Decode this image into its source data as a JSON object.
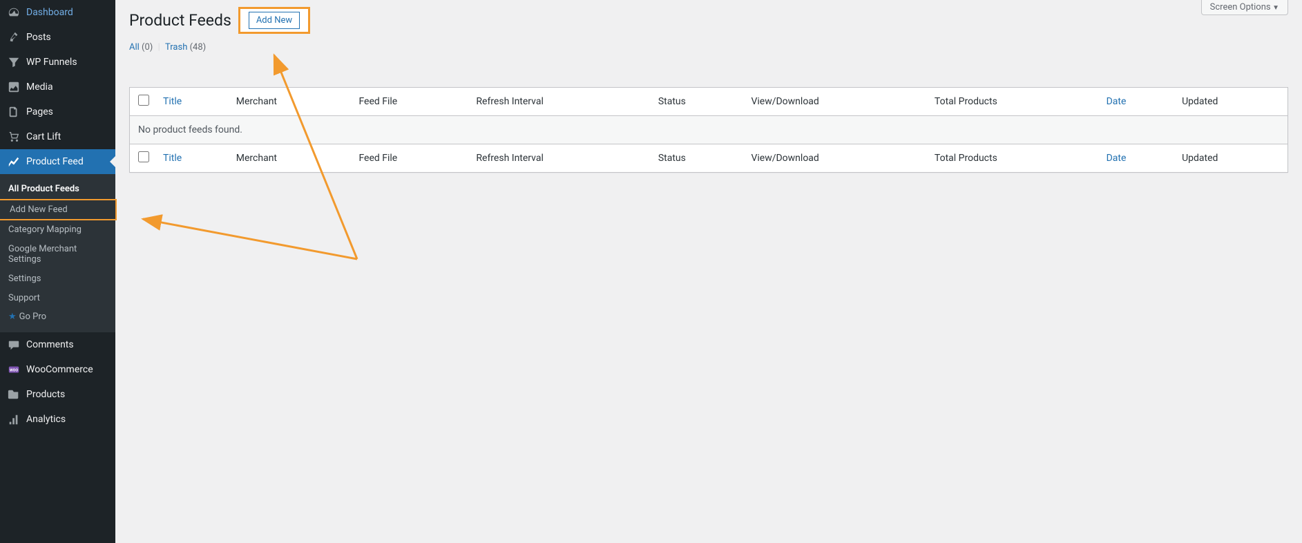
{
  "sidebar": {
    "items": [
      {
        "label": "Dashboard",
        "icon": "dashboard"
      },
      {
        "label": "Posts",
        "icon": "pin"
      },
      {
        "label": "WP Funnels",
        "icon": "funnel"
      },
      {
        "label": "Media",
        "icon": "media"
      },
      {
        "label": "Pages",
        "icon": "pages"
      },
      {
        "label": "Cart Lift",
        "icon": "cart"
      },
      {
        "label": "Product Feed",
        "icon": "chart"
      },
      {
        "label": "Comments",
        "icon": "comment"
      },
      {
        "label": "WooCommerce",
        "icon": "woo"
      },
      {
        "label": "Products",
        "icon": "products"
      },
      {
        "label": "Analytics",
        "icon": "analytics"
      }
    ],
    "submenu": {
      "items": [
        {
          "label": "All Product Feeds"
        },
        {
          "label": "Add New Feed"
        },
        {
          "label": "Category Mapping"
        },
        {
          "label": "Google Merchant Settings"
        },
        {
          "label": "Settings"
        },
        {
          "label": "Support"
        },
        {
          "label": "Go Pro"
        }
      ]
    }
  },
  "header": {
    "screen_options": "Screen Options",
    "page_title": "Product Feeds",
    "add_new": "Add New"
  },
  "filters": {
    "all_label": "All",
    "all_count": "(0)",
    "trash_label": "Trash",
    "trash_count": "(48)"
  },
  "table": {
    "columns": {
      "title": "Title",
      "merchant": "Merchant",
      "feed_file": "Feed File",
      "refresh_interval": "Refresh Interval",
      "status": "Status",
      "view_download": "View/Download",
      "total_products": "Total Products",
      "date": "Date",
      "updated": "Updated"
    },
    "empty_message": "No product feeds found."
  },
  "annotation": {
    "highlight_color": "#f29a2e"
  }
}
